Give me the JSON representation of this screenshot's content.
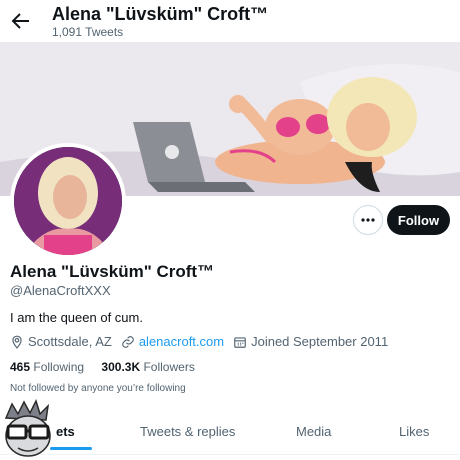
{
  "header": {
    "back_icon": "arrow-left-icon",
    "display_name": "Alena \"Lüvsküm\" Croft™",
    "tweet_count": "1,091 Tweets"
  },
  "profile": {
    "display_name": "Alena \"Lüvsküm\" Croft™",
    "handle": "@AlenaCroftXXX",
    "bio": "I am the queen of cum.",
    "location": "Scottsdale, AZ",
    "website": "alenacroft.com",
    "joined": "Joined September 2011",
    "following_count": "465",
    "following_label": "Following",
    "followers_count": "300.3K",
    "followers_label": "Followers",
    "followed_by_note": "Not followed by anyone you’re following"
  },
  "actions": {
    "more_icon": "ellipsis-icon",
    "follow_label": "Follow"
  },
  "tabs": [
    {
      "label": "Tweets",
      "visible_text": "ets",
      "active": true
    },
    {
      "label": "Tweets & replies",
      "active": false
    },
    {
      "label": "Media",
      "active": false
    },
    {
      "label": "Likes",
      "active": false
    }
  ],
  "colors": {
    "accent": "#1d9bf0",
    "text_primary": "#0f1419",
    "text_secondary": "#536471",
    "follow_bg": "#0f1419"
  }
}
